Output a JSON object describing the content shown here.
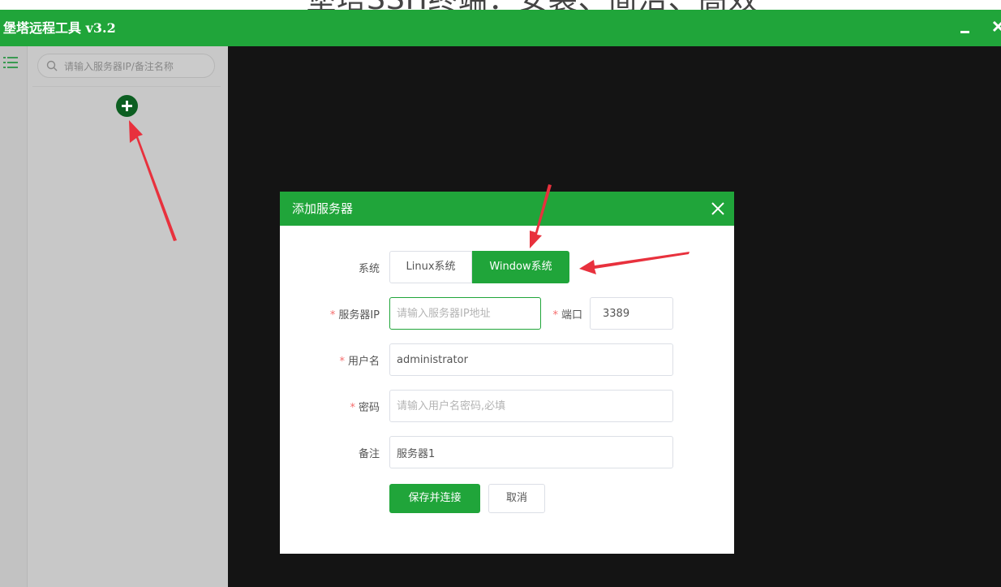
{
  "banner": {
    "text": "堡塔SSH终端：安装、简洁、高效"
  },
  "window": {
    "title": "堡塔远程工具 v3.2"
  },
  "sidebar": {
    "search_placeholder": "请输入服务器IP/备注名称"
  },
  "dialog": {
    "title": "添加服务器",
    "system_label": "系统",
    "system_options": [
      "Linux系统",
      "Window系统"
    ],
    "system_selected": "Window系统",
    "server_ip_label": "服务器IP",
    "server_ip_placeholder": "请输入服务器IP地址",
    "port_label": "端口",
    "port_value": "3389",
    "username_label": "用户名",
    "username_value": "administrator",
    "password_label": "密码",
    "password_placeholder": "请输入用户名密码,必填",
    "remark_label": "备注",
    "remark_value": "服务器1",
    "save_button": "保存并连接",
    "cancel_button": "取消"
  },
  "colors": {
    "accent": "#20a53a",
    "required": "#f56c6c",
    "annotation_arrow": "#e8313d",
    "terminal_bg": "#141414"
  },
  "icons": [
    "list-icon",
    "search-icon",
    "plus-icon",
    "minimize-icon",
    "close-icon"
  ]
}
